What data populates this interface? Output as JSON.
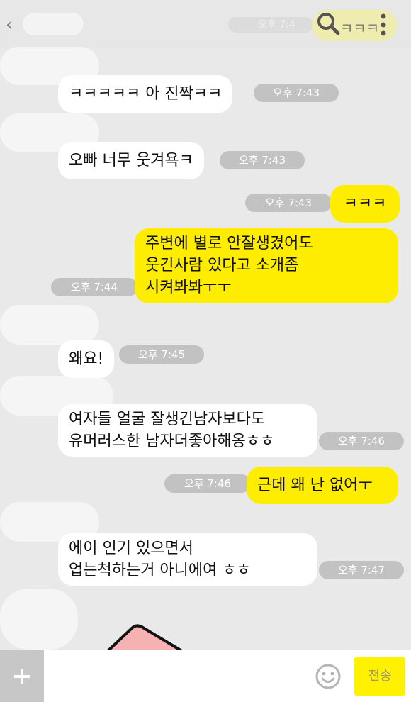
{
  "header": {
    "back_icon": "chevron-left-icon",
    "top_time": "오후 7:4",
    "top_preview": "ㅋㅋㅋ",
    "search_icon": "search-icon",
    "menu_icon": "more-vertical-icon"
  },
  "messages": [
    {
      "side": "in",
      "text": "ㅋㅋㅋㅋㅋ 아 진짝ㅋㅋ",
      "time": "오후 7:43"
    },
    {
      "side": "in",
      "text": "오빠 너무 웃겨욕ㅋ",
      "time": "오후 7:43"
    },
    {
      "side": "out",
      "text": "ㅋㅋㅋ",
      "time": "오후 7:43"
    },
    {
      "side": "out",
      "text": "주변에 별로 안잘생겼어도\n웃긴사람 있다고 소개좀\n시켜봐봐ㅜㅜ",
      "time": "오후 7:44"
    },
    {
      "side": "in",
      "text": "왜요!",
      "time": "오후 7:45"
    },
    {
      "side": "in",
      "text": "여자들 얼굴 잘생긴남자보다도\n유머러스한 남자더좋아해옹ㅎㅎ",
      "time": "오후 7:46"
    },
    {
      "side": "out",
      "text": "근데 왜 난 없어ㅜ",
      "time": "오후 7:46"
    },
    {
      "side": "in",
      "text": "에이 인기 있으면서\n업는척하는거 아니에여 ㅎㅎ",
      "time": "오후 7:47"
    }
  ],
  "input": {
    "plus_icon": "plus-icon",
    "emoji_icon": "smiley-icon",
    "send_label": "전송"
  },
  "colors": {
    "background": "#e9e9e9",
    "incoming_bubble": "#ffffff",
    "outgoing_bubble": "#ffed00",
    "time_pill": "#c2c2c2",
    "send_button": "#fff100"
  }
}
